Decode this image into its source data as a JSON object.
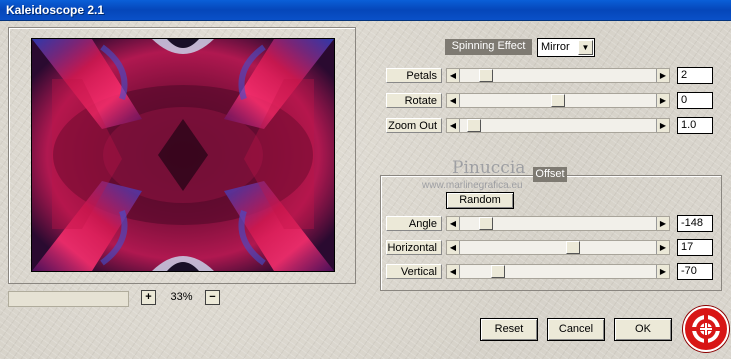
{
  "window": {
    "title": "Kaleidoscope 2.1"
  },
  "preview": {
    "zoom_in_label": "+",
    "zoom_out_label": "−",
    "zoom_value": "33%"
  },
  "spinning_effect": {
    "title": "Spinning Effect",
    "mode": {
      "selected": "Mirror"
    },
    "sliders": [
      {
        "label": "Petals",
        "value": "2",
        "position": 0.07
      },
      {
        "label": "Rotate",
        "value": "0",
        "position": 0.5
      },
      {
        "label": "Zoom Out",
        "value": "1.0",
        "position": 0.03
      }
    ]
  },
  "offset": {
    "title": "Offset",
    "random_label": "Random",
    "sliders": [
      {
        "label": "Angle",
        "value": "-148",
        "position": 0.12
      },
      {
        "label": "Horizontal",
        "value": "17",
        "position": 0.58
      },
      {
        "label": "Vertical",
        "value": "-70",
        "position": 0.2
      }
    ]
  },
  "watermark": {
    "name": "Pinuccia",
    "url": "www.marlinegrafica.eu"
  },
  "buttons": {
    "reset": "Reset",
    "cancel": "Cancel",
    "ok": "OK"
  },
  "icons": {
    "arrow_left": "left-arrow-icon",
    "arrow_right": "right-arrow-icon",
    "dropdown": "chevron-down-icon",
    "logo": "lifebuoy-logo-icon"
  },
  "colors": {
    "titlebar": "#0a5fd8",
    "section_label_bg": "#7e7a72",
    "logo_red": "#d81616"
  }
}
